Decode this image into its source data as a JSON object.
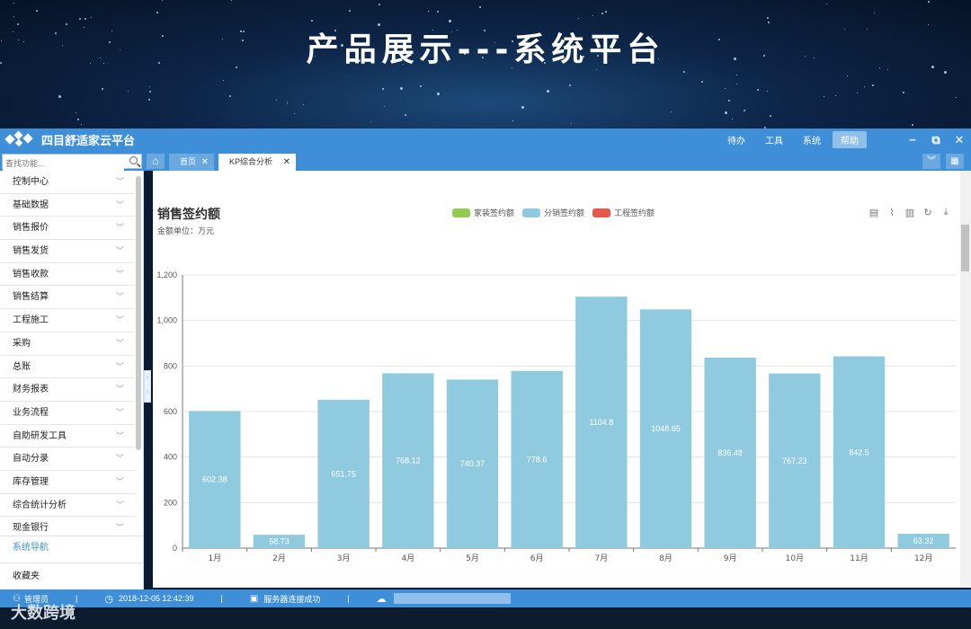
{
  "banner": {
    "title": "产品展示---系统平台"
  },
  "app": {
    "name": "四目舒适家云平台",
    "menu": [
      {
        "label": "待办",
        "active": false
      },
      {
        "label": "工具",
        "active": false
      },
      {
        "label": "系统",
        "active": false
      },
      {
        "label": "帮助",
        "active": true
      }
    ],
    "window_buttons": [
      "−",
      "⧉",
      "✕"
    ]
  },
  "search": {
    "placeholder": "查找功能..."
  },
  "tabs": [
    {
      "label": "首页",
      "active": false
    },
    {
      "label": "KP综合分析",
      "active": true
    }
  ],
  "sidebar": {
    "items": [
      "控制中心",
      "基础数据",
      "销售报价",
      "销售发货",
      "销售收款",
      "销售结算",
      "工程施工",
      "采购",
      "总账",
      "财务报表",
      "业务流程",
      "自助研发工具",
      "自动分录",
      "库存管理",
      "综合统计分析",
      "现金银行"
    ],
    "nav_label": "系统导航",
    "fav_label": "收藏夹"
  },
  "chart_data": {
    "type": "bar",
    "title": "销售签约额",
    "subtitle": "金额单位：万元",
    "legend": [
      {
        "name": "家装签约额",
        "color": "#91cc50"
      },
      {
        "name": "分销签约额",
        "color": "#8fcade"
      },
      {
        "name": "工程签约额",
        "color": "#e8574b"
      }
    ],
    "categories": [
      "1月",
      "2月",
      "3月",
      "4月",
      "5月",
      "6月",
      "7月",
      "8月",
      "9月",
      "10月",
      "11月",
      "12月"
    ],
    "series": [
      {
        "name": "分销签约额",
        "color": "#8fcade",
        "values": [
          602.38,
          58.73,
          651.75,
          768.12,
          740.37,
          778.6,
          1104.8,
          1048.65,
          836.48,
          767.23,
          842.5,
          63.32
        ]
      }
    ],
    "y_ticks": [
      "0",
      "200",
      "400",
      "600",
      "800",
      "1,000",
      "1,200"
    ],
    "ylim": [
      0,
      1200
    ],
    "grid": true
  },
  "toolbox_icons": [
    "data-view-icon",
    "line-chart-icon",
    "bar-chart-icon",
    "refresh-icon",
    "download-icon"
  ],
  "status": {
    "user": "管理员",
    "datetime": "2018-12-05 12:42:39",
    "server": "服务器连接成功"
  },
  "watermark": "大数跨境"
}
